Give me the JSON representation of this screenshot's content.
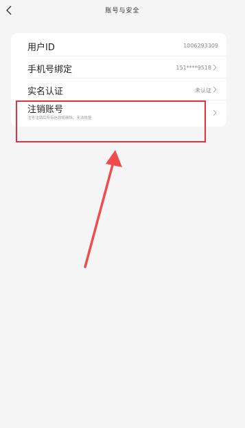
{
  "header": {
    "title": "账号与安全"
  },
  "rows": [
    {
      "label": "用户ID",
      "value": "1006293309"
    },
    {
      "label": "手机号绑定",
      "value": "151****9518"
    },
    {
      "label": "实名认证",
      "value": "未认证"
    },
    {
      "label": "注销账号",
      "desc": "注号注销后所有信息将删除，无法恢复"
    }
  ],
  "icons": {
    "back": "chevron-left-icon",
    "row_arrow": "chevron-right-icon"
  },
  "colors": {
    "annotation": "#e3323a",
    "background": "#f5f5f5"
  }
}
